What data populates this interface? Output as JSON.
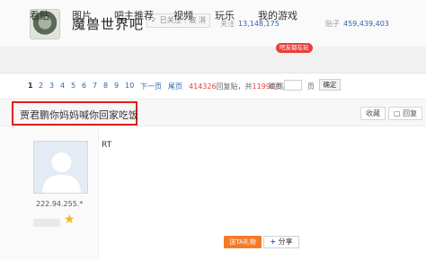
{
  "header": {
    "forum_name": "魔兽世界吧",
    "follow_status": "已关注",
    "unfollow": "取 消",
    "follow_label": "关注",
    "follow_count": "13,148,175",
    "posts_label": "贴子",
    "posts_count": "459,439,403"
  },
  "nav": {
    "items": [
      "看贴",
      "图片",
      "吧主推荐",
      "视频",
      "玩乐",
      "我的游戏"
    ],
    "badge": "吧友都在玩"
  },
  "pager": {
    "pages": [
      "1",
      "2",
      "3",
      "4",
      "5",
      "6",
      "7",
      "8",
      "9",
      "10"
    ],
    "next": "下一页",
    "last": "尾页",
    "reply_count": "414326",
    "reply_suffix": "回复贴，共",
    "page_count": "11990",
    "page_suffix": "页，",
    "jump_label": "跳到",
    "page_unit": "页",
    "ok": "确定"
  },
  "post": {
    "title": "贾君鹏你妈妈喊你回家吃饭",
    "collect": "收藏",
    "reply": "回复",
    "ip": "222.94.255.*",
    "content": "RT",
    "gift": "送TA礼物",
    "share": "分享"
  },
  "colors": {
    "accent_blue": "#2d64b3",
    "red": "#e6403b",
    "orange": "#f47b28"
  }
}
